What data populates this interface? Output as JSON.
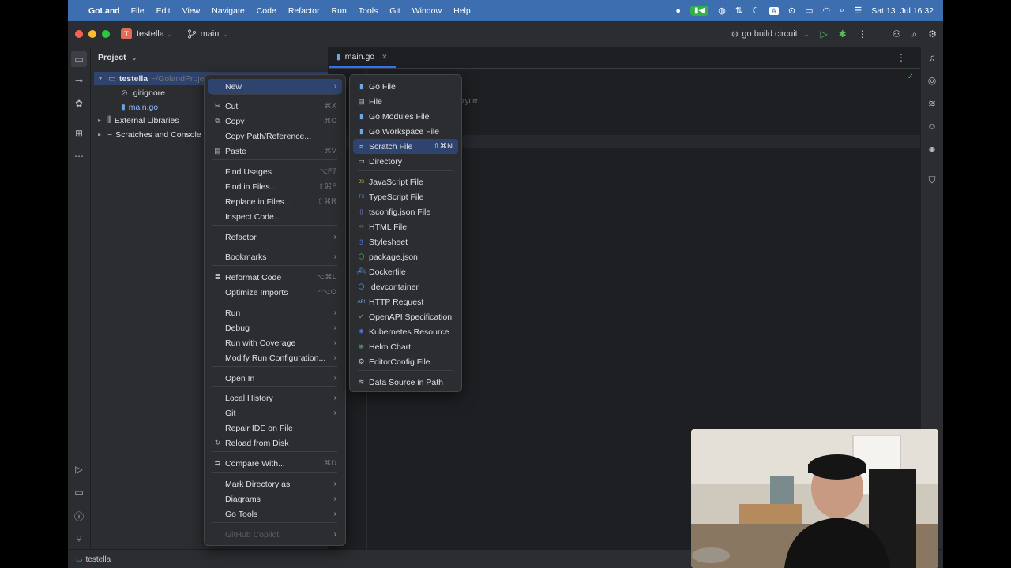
{
  "menubar": {
    "app_name": "GoLand",
    "items": [
      "File",
      "Edit",
      "View",
      "Navigate",
      "Code",
      "Refactor",
      "Run",
      "Tools",
      "Git",
      "Window",
      "Help"
    ],
    "clock": "Sat 13. Jul  16:32"
  },
  "titlebar": {
    "project_badge": "T",
    "project": "testella",
    "branch": "main",
    "run_config": "go build circuit"
  },
  "project_panel": {
    "title": "Project",
    "root_name": "testella",
    "root_path": "~/GolandProje",
    "files": [
      ".gitignore",
      "main.go"
    ],
    "external_libraries": "External Libraries",
    "scratches": "Scratches and Console"
  },
  "editor": {
    "tab": "main.go",
    "visible_text": "fa Ozyurt"
  },
  "context_menu": {
    "items": [
      {
        "label": "New",
        "shortcut": "",
        "submenu": true
      },
      {
        "label": "Cut",
        "shortcut": "⌘X",
        "submenu": false
      },
      {
        "label": "Copy",
        "shortcut": "⌘C",
        "submenu": false
      },
      {
        "label": "Copy Path/Reference...",
        "shortcut": "",
        "submenu": false
      },
      {
        "label": "Paste",
        "shortcut": "⌘V",
        "submenu": false
      },
      {
        "label": "Find Usages",
        "shortcut": "⌥F7",
        "submenu": false
      },
      {
        "label": "Find in Files...",
        "shortcut": "⇧⌘F",
        "submenu": false
      },
      {
        "label": "Replace in Files...",
        "shortcut": "⇧⌘R",
        "submenu": false
      },
      {
        "label": "Inspect Code...",
        "shortcut": "",
        "submenu": false
      },
      {
        "label": "Refactor",
        "shortcut": "",
        "submenu": true
      },
      {
        "label": "Bookmarks",
        "shortcut": "",
        "submenu": true
      },
      {
        "label": "Reformat Code",
        "shortcut": "⌥⌘L",
        "submenu": false
      },
      {
        "label": "Optimize Imports",
        "shortcut": "^⌥O",
        "submenu": false
      },
      {
        "label": "Run",
        "shortcut": "",
        "submenu": true
      },
      {
        "label": "Debug",
        "shortcut": "",
        "submenu": true
      },
      {
        "label": "Run with Coverage",
        "shortcut": "",
        "submenu": true
      },
      {
        "label": "Modify Run Configuration...",
        "shortcut": "",
        "submenu": true
      },
      {
        "label": "Open In",
        "shortcut": "",
        "submenu": true
      },
      {
        "label": "Local History",
        "shortcut": "",
        "submenu": true
      },
      {
        "label": "Git",
        "shortcut": "",
        "submenu": true
      },
      {
        "label": "Repair IDE on File",
        "shortcut": "",
        "submenu": false
      },
      {
        "label": "Reload from Disk",
        "shortcut": "",
        "submenu": false
      },
      {
        "label": "Compare With...",
        "shortcut": "⌘D",
        "submenu": false
      },
      {
        "label": "Mark Directory as",
        "shortcut": "",
        "submenu": true
      },
      {
        "label": "Diagrams",
        "shortcut": "",
        "submenu": true
      },
      {
        "label": "Go Tools",
        "shortcut": "",
        "submenu": true
      },
      {
        "label": "GitHub Copilot",
        "shortcut": "",
        "submenu": true
      }
    ]
  },
  "new_submenu": {
    "items": [
      {
        "label": "Go File",
        "shortcut": "",
        "icon": "go-file-icon"
      },
      {
        "label": "File",
        "shortcut": "",
        "icon": "file-icon"
      },
      {
        "label": "Go Modules File",
        "shortcut": "",
        "icon": "go-modules-icon"
      },
      {
        "label": "Go Workspace File",
        "shortcut": "",
        "icon": "go-workspace-icon"
      },
      {
        "label": "Scratch File",
        "shortcut": "⇧⌘N",
        "icon": "scratch-file-icon"
      },
      {
        "label": "Directory",
        "shortcut": "",
        "icon": "folder-icon"
      },
      {
        "label": "JavaScript File",
        "shortcut": "",
        "icon": "javascript-icon"
      },
      {
        "label": "TypeScript File",
        "shortcut": "",
        "icon": "typescript-icon"
      },
      {
        "label": "tsconfig.json File",
        "shortcut": "",
        "icon": "tsconfig-icon"
      },
      {
        "label": "HTML File",
        "shortcut": "",
        "icon": "html-icon"
      },
      {
        "label": "Stylesheet",
        "shortcut": "",
        "icon": "css-icon"
      },
      {
        "label": "package.json",
        "shortcut": "",
        "icon": "package-json-icon"
      },
      {
        "label": "Dockerfile",
        "shortcut": "",
        "icon": "docker-icon"
      },
      {
        "label": ".devcontainer",
        "shortcut": "",
        "icon": "devcontainer-icon"
      },
      {
        "label": "HTTP Request",
        "shortcut": "",
        "icon": "http-request-icon"
      },
      {
        "label": "OpenAPI Specification",
        "shortcut": "",
        "icon": "openapi-icon"
      },
      {
        "label": "Kubernetes Resource",
        "shortcut": "",
        "icon": "kubernetes-icon"
      },
      {
        "label": "Helm Chart",
        "shortcut": "",
        "icon": "helm-icon"
      },
      {
        "label": "EditorConfig File",
        "shortcut": "",
        "icon": "editorconfig-icon"
      },
      {
        "label": "Data Source in Path",
        "shortcut": "",
        "icon": "database-icon"
      }
    ]
  },
  "statusbar": {
    "project": "testella"
  },
  "colors": {
    "accent": "#3574f0",
    "highlight": "#2e436e",
    "menubar": "#3d6eb0"
  }
}
